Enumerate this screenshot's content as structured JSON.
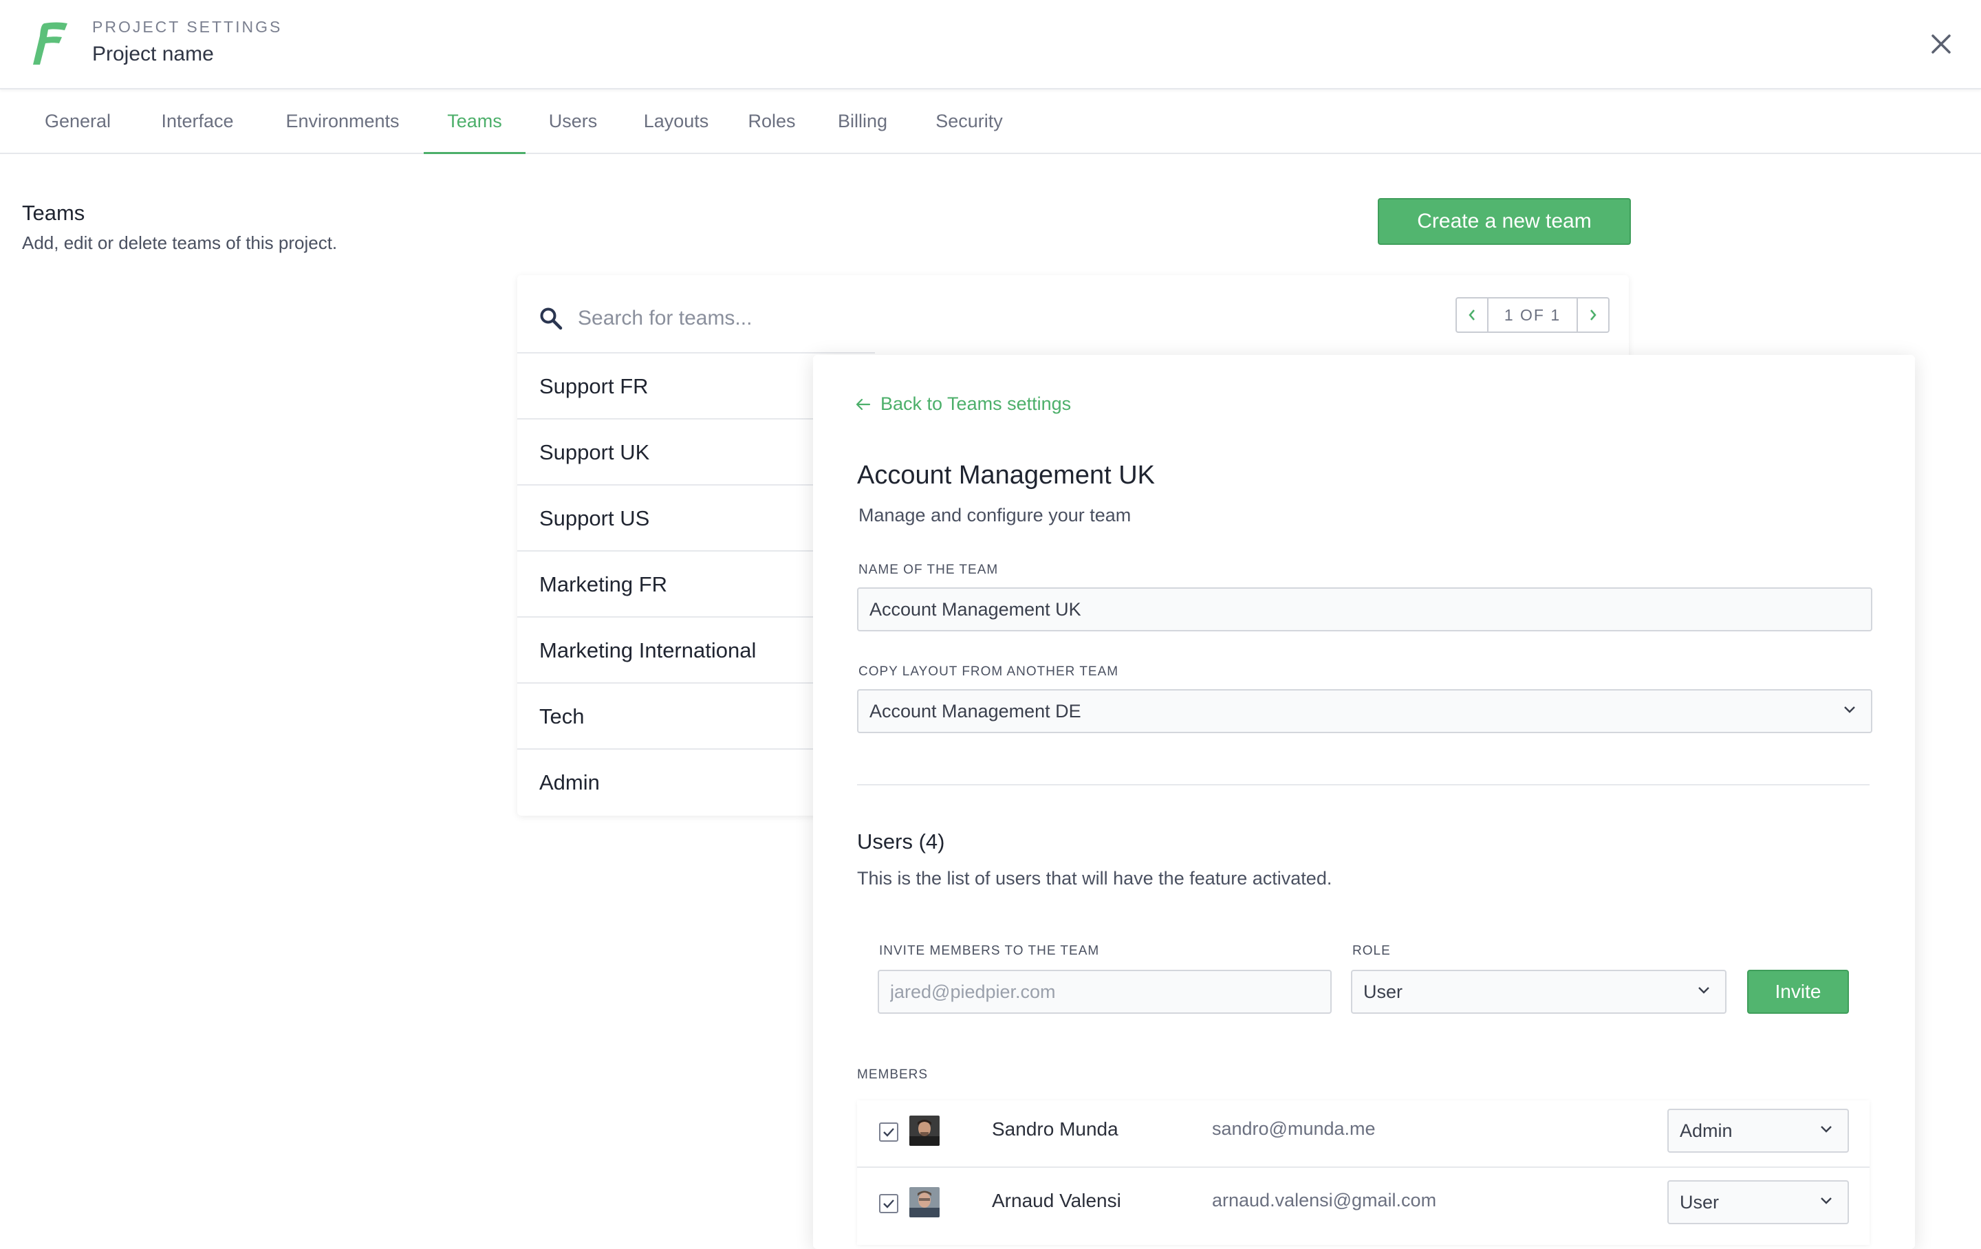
{
  "header": {
    "subtitle": "PROJECT SETTINGS",
    "title": "Project name"
  },
  "tabs": [
    {
      "label": "General"
    },
    {
      "label": "Interface"
    },
    {
      "label": "Environments"
    },
    {
      "label": "Teams",
      "active": true
    },
    {
      "label": "Users"
    },
    {
      "label": "Layouts"
    },
    {
      "label": "Roles"
    },
    {
      "label": "Billing"
    },
    {
      "label": "Security"
    }
  ],
  "section": {
    "title": "Teams",
    "description": "Add, edit or delete teams of this project.",
    "create_button": "Create a new team"
  },
  "search": {
    "placeholder": "Search for teams...",
    "pager": "1 OF 1"
  },
  "teams": [
    "Support FR",
    "Support UK",
    "Support US",
    "Marketing FR",
    "Marketing International",
    "Tech",
    "Admin"
  ],
  "detail": {
    "back_label": "Back to Teams settings",
    "title": "Account Management UK",
    "description": "Manage and configure your team",
    "name_label": "NAME OF THE TEAM",
    "name_value": "Account Management UK",
    "copy_label": "COPY LAYOUT FROM ANOTHER TEAM",
    "copy_value": "Account Management DE",
    "users_title": "Users (4)",
    "users_description": "This is the list of users that will have the feature activated.",
    "invite_label": "INVITE MEMBERS TO THE TEAM",
    "invite_placeholder": "jared@piedpier.com",
    "role_label": "ROLE",
    "role_value": "User",
    "invite_button": "Invite",
    "members_label": "MEMBERS",
    "members": [
      {
        "name": "Sandro Munda",
        "email": "sandro@munda.me",
        "role": "Admin",
        "checked": true
      },
      {
        "name": "Arnaud Valensi",
        "email": "arnaud.valensi@gmail.com",
        "role": "User",
        "checked": true
      }
    ]
  },
  "colors": {
    "accent": "#4caf6a",
    "button": "#52b56f"
  }
}
